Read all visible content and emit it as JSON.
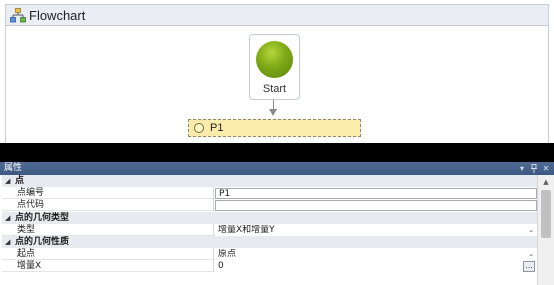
{
  "flowchart": {
    "title": "Flowchart",
    "icon": "flowchart-icon",
    "start_node": {
      "label": "Start",
      "color": "#7ea816"
    },
    "step_node": {
      "label": "P1",
      "color": "#fbecab"
    }
  },
  "properties_panel": {
    "title": "属性",
    "buttons": [
      "dropdown-arrow-icon",
      "pin-icon",
      "close-icon"
    ],
    "categories": [
      {
        "label": "点",
        "expanded": true,
        "properties": [
          {
            "name": "点编号",
            "value": "P1",
            "editor": "text"
          },
          {
            "name": "点代码",
            "value": "",
            "editor": "text"
          }
        ]
      },
      {
        "label": "点的几何类型",
        "expanded": true,
        "properties": [
          {
            "name": "类型",
            "value": "增量X和增量Y",
            "editor": "combo"
          }
        ]
      },
      {
        "label": "点的几何性质",
        "expanded": true,
        "properties": [
          {
            "name": "起点",
            "value": "原点",
            "editor": "combo"
          },
          {
            "name": "增量X",
            "value": "0",
            "editor": "ellipsis"
          }
        ]
      }
    ]
  },
  "colors": {
    "titlebar": "#3d5a82",
    "category_band": "#e7eaee",
    "step_fill": "#fbecab"
  }
}
